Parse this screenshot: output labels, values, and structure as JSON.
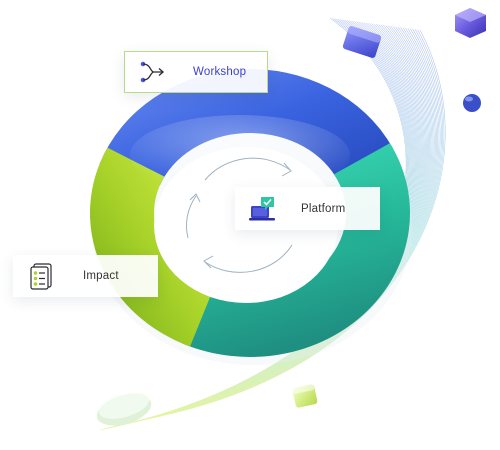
{
  "nodes": [
    {
      "id": "workshop",
      "label": "Workshop",
      "icon": "branch-arrow-icon"
    },
    {
      "id": "platform",
      "label": "Platform",
      "icon": "laptop-chat-icon"
    },
    {
      "id": "impact",
      "label": "Impact",
      "icon": "checklist-icon"
    }
  ],
  "colors": {
    "segment_blue": "#3a63e0",
    "segment_teal": "#2fc6a3",
    "segment_green": "#a9d32a",
    "accent_violet": "#5b4fd6",
    "ribbon_blue": "#3f6fd8",
    "ribbon_green": "#c6e64a",
    "workshop_label": "#3b3fc9",
    "workshop_border": "#b9d98b"
  }
}
